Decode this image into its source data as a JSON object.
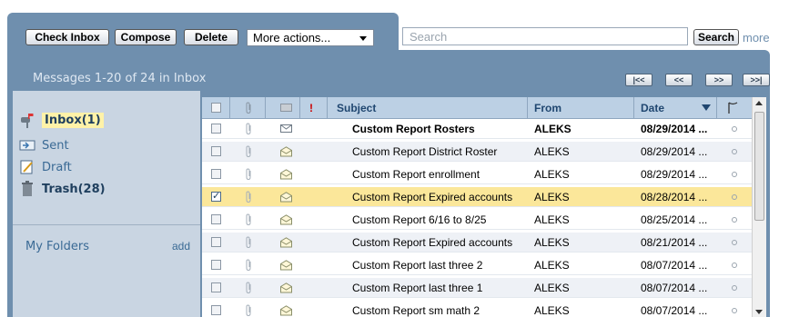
{
  "toolbar": {
    "check_inbox": "Check Inbox",
    "compose": "Compose",
    "delete": "Delete",
    "more_actions": "More actions...",
    "search_placeholder": "Search",
    "search_button": "Search",
    "more_link": "more"
  },
  "status": {
    "message_count": "Messages 1-20 of 24 in Inbox"
  },
  "pager": {
    "first": "|<<",
    "prev": "<<",
    "next": ">>",
    "last": ">>|"
  },
  "sidebar": {
    "items": [
      {
        "label": "Inbox(1)",
        "icon": "mailbox-icon"
      },
      {
        "label": "Sent",
        "icon": "sent-icon"
      },
      {
        "label": "Draft",
        "icon": "draft-icon"
      },
      {
        "label": "Trash(28)",
        "icon": "trash-icon"
      }
    ],
    "folders_label": "My Folders",
    "add_label": "add"
  },
  "table": {
    "headers": {
      "priority": "!",
      "subject": "Subject",
      "from": "From",
      "date": "Date"
    },
    "rows": [
      {
        "subject": "Custom Report Rosters",
        "from": "ALEKS",
        "date": "08/29/2014 ...",
        "unread": true,
        "checked": false
      },
      {
        "subject": "Custom Report District Roster",
        "from": "ALEKS",
        "date": "08/29/2014 ...",
        "unread": false,
        "checked": false
      },
      {
        "subject": "Custom Report enrollment",
        "from": "ALEKS",
        "date": "08/29/2014 ...",
        "unread": false,
        "checked": false
      },
      {
        "subject": "Custom Report Expired accounts",
        "from": "ALEKS",
        "date": "08/28/2014 ...",
        "unread": false,
        "checked": true
      },
      {
        "subject": "Custom Report 6/16 to 8/25",
        "from": "ALEKS",
        "date": "08/25/2014 ...",
        "unread": false,
        "checked": false
      },
      {
        "subject": "Custom Report Expired accounts",
        "from": "ALEKS",
        "date": "08/21/2014 ...",
        "unread": false,
        "checked": false
      },
      {
        "subject": "Custom Report last three 2",
        "from": "ALEKS",
        "date": "08/07/2014 ...",
        "unread": false,
        "checked": false
      },
      {
        "subject": "Custom Report last three 1",
        "from": "ALEKS",
        "date": "08/07/2014 ...",
        "unread": false,
        "checked": false
      },
      {
        "subject": "Custom Report sm math 2",
        "from": "ALEKS",
        "date": "08/07/2014 ...",
        "unread": false,
        "checked": false
      }
    ]
  },
  "colors": {
    "panel": "#6f8fae",
    "sidebar": "#c9d5e2",
    "header": "#bcd0e4",
    "selected_row": "#fbe79a"
  }
}
